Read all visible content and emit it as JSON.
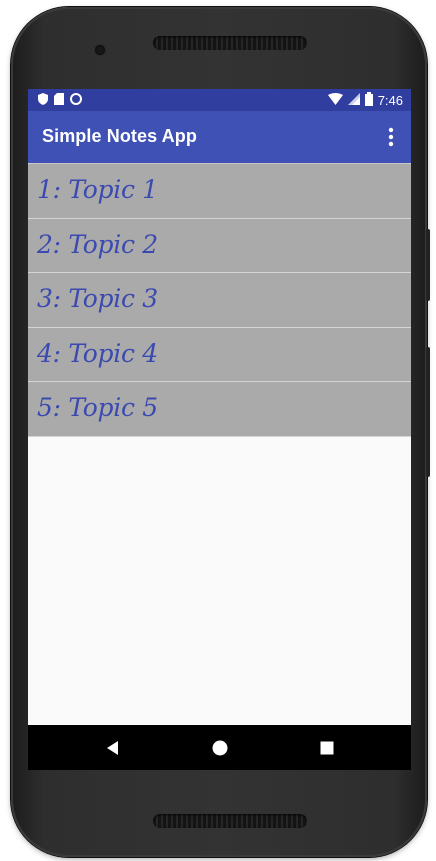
{
  "status_bar": {
    "time": "7:46",
    "left_icons": [
      "shield-icon",
      "sd-card-icon",
      "sync-circle-icon"
    ],
    "right_icons": [
      "wifi-icon",
      "cell-signal-icon",
      "battery-icon"
    ]
  },
  "app_bar": {
    "title": "Simple Notes App",
    "overflow_icon": "more-vert-icon"
  },
  "topics": [
    {
      "label": "1: Topic 1"
    },
    {
      "label": "2: Topic 2"
    },
    {
      "label": "3: Topic 3"
    },
    {
      "label": "4: Topic 4"
    },
    {
      "label": "5: Topic 5"
    }
  ],
  "nav_bar": {
    "icons": [
      "back-icon",
      "home-icon",
      "recents-icon"
    ]
  },
  "colors": {
    "status_bar": "#303f9f",
    "app_bar": "#3f51b5",
    "list_item_bg": "#aaaaaa",
    "list_item_text": "#3a4ab0",
    "screen_bg": "#fafafa"
  }
}
